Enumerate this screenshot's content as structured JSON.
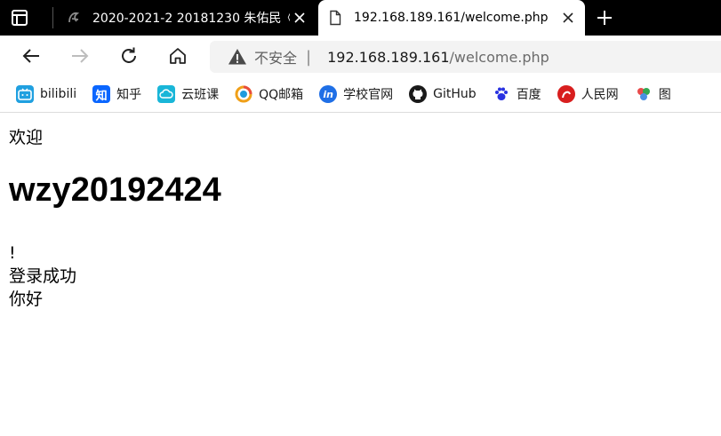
{
  "tabs": [
    {
      "title": "2020-2021-2 20181230 朱佑民《",
      "active": false
    },
    {
      "title": "192.168.189.161/welcome.php",
      "active": true
    }
  ],
  "address": {
    "security_label": "不安全",
    "separator": "|",
    "host": "192.168.189.161",
    "path": "/welcome.php"
  },
  "bookmarks": [
    {
      "label": "bilibili",
      "icon": "bilibili-icon",
      "color": "#20a0e0"
    },
    {
      "label": "知乎",
      "icon": "zhihu-icon",
      "color": "#0a66ff"
    },
    {
      "label": "云班课",
      "icon": "cloud-class-icon",
      "color": "#19b6d8"
    },
    {
      "label": "QQ邮箱",
      "icon": "qqmail-icon",
      "color": "#f0a019"
    },
    {
      "label": "学校官网",
      "icon": "school-icon",
      "color": "#1f6fe6"
    },
    {
      "label": "GitHub",
      "icon": "github-icon",
      "color": "#1a1a1a"
    },
    {
      "label": "百度",
      "icon": "baidu-icon",
      "color": "#2932e1"
    },
    {
      "label": "人民网",
      "icon": "people-icon",
      "color": "#d81e1e"
    },
    {
      "label": "图",
      "icon": "tu-icon",
      "color": "#e94b4b"
    }
  ],
  "page": {
    "greeting": "欢迎",
    "username": "wzy20192424",
    "exclamation": "!",
    "status": "登录成功",
    "hello": "你好"
  },
  "colors": {
    "tabstrip": "#000000",
    "active_tab": "#ffffff",
    "address_bg": "#f3f3f3"
  }
}
